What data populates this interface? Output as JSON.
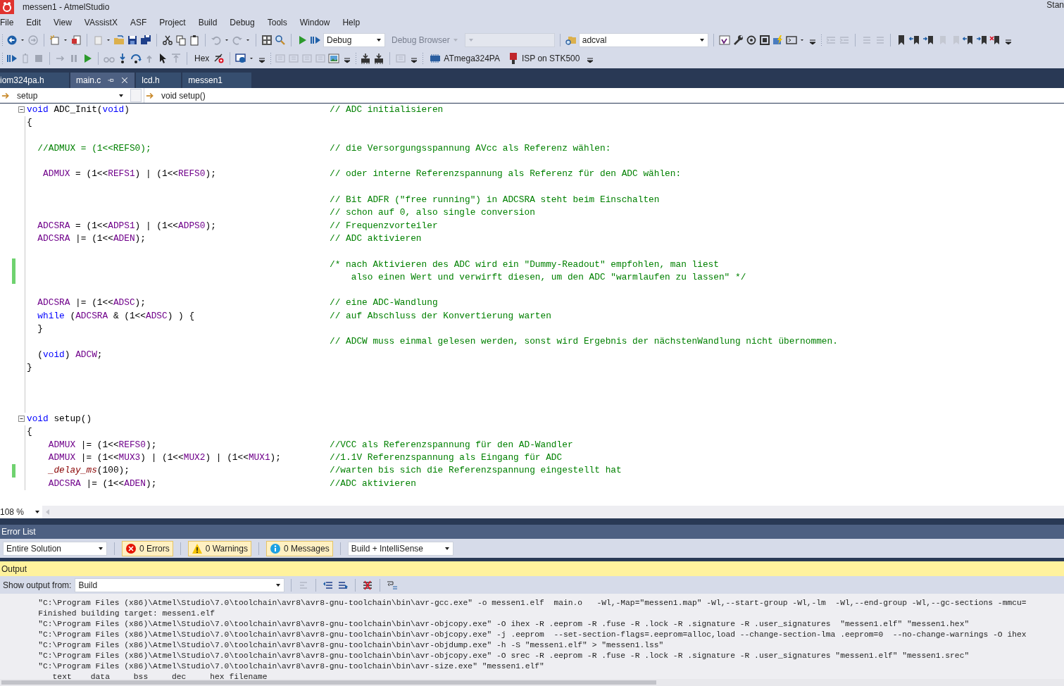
{
  "window": {
    "title": "messen1 - AtmelStudio",
    "corner_text": "Stan"
  },
  "menu": [
    "File",
    "Edit",
    "View",
    "VAssistX",
    "ASF",
    "Project",
    "Build",
    "Debug",
    "Tools",
    "Window",
    "Help"
  ],
  "toolbar": {
    "configuration": "Debug",
    "debug_browser": "Debug Browser",
    "find": "adcval"
  },
  "debug_toolbar": {
    "hex": "Hex",
    "device": "ATmega324PA",
    "tool": "ISP on STK500"
  },
  "tabs": [
    {
      "label": "iom324pa.h",
      "selected": false
    },
    {
      "label": "main.c",
      "selected": true
    },
    {
      "label": "lcd.h",
      "selected": false
    },
    {
      "label": "messen1",
      "selected": false
    }
  ],
  "navigation": {
    "scope": "setup",
    "member": "void setup()"
  },
  "editor": {
    "zoom": "108 %",
    "lines": [
      {
        "changed": false,
        "fold": true,
        "code": [
          {
            "kind": "keyword",
            "text": "void"
          },
          {
            "kind": "plain",
            "text": " ADC_Init("
          },
          {
            "kind": "keyword",
            "text": "void"
          },
          {
            "kind": "plain",
            "text": ")"
          }
        ],
        "comment": "// ADC initialisieren"
      },
      {
        "changed": false,
        "fold": false,
        "code": [
          {
            "kind": "plain",
            "text": "{"
          }
        ]
      },
      {
        "changed": false,
        "fold": false
      },
      {
        "changed": false,
        "fold": false,
        "code": [
          {
            "kind": "comment",
            "text": "  //ADMUX = (1<<REFS0);"
          }
        ],
        "comment": "// die Versorgungsspannung AVcc als Referenz wählen:"
      },
      {
        "changed": false,
        "fold": false
      },
      {
        "changed": false,
        "fold": false,
        "code": [
          {
            "kind": "macro",
            "text": "   ADMUX"
          },
          {
            "kind": "plain",
            "text": " = (1<<"
          },
          {
            "kind": "macro",
            "text": "REFS1"
          },
          {
            "kind": "plain",
            "text": ") | (1<<"
          },
          {
            "kind": "macro",
            "text": "REFS0"
          },
          {
            "kind": "plain",
            "text": ");"
          }
        ],
        "comment": "// oder interne Referenzspannung als Referenz für den ADC wählen:"
      },
      {
        "changed": false,
        "fold": false
      },
      {
        "changed": false,
        "fold": false,
        "comment": "// Bit ADFR (\"free running\") in ADCSRA steht beim Einschalten"
      },
      {
        "changed": false,
        "fold": false,
        "comment": "// schon auf 0, also single conversion"
      },
      {
        "changed": false,
        "fold": false,
        "code": [
          {
            "kind": "macro",
            "text": "  ADCSRA"
          },
          {
            "kind": "plain",
            "text": " = (1<<"
          },
          {
            "kind": "macro",
            "text": "ADPS1"
          },
          {
            "kind": "plain",
            "text": ") | (1<<"
          },
          {
            "kind": "macro",
            "text": "ADPS0"
          },
          {
            "kind": "plain",
            "text": ");"
          }
        ],
        "comment": "// Frequenzvorteiler"
      },
      {
        "changed": false,
        "fold": false,
        "code": [
          {
            "kind": "macro",
            "text": "  ADCSRA"
          },
          {
            "kind": "plain",
            "text": " |= (1<<"
          },
          {
            "kind": "macro",
            "text": "ADEN"
          },
          {
            "kind": "plain",
            "text": ");"
          }
        ],
        "comment": "// ADC aktivieren"
      },
      {
        "changed": false,
        "fold": false
      },
      {
        "changed": true,
        "fold": false,
        "comment": "/* nach Aktivieren des ADC wird ein \"Dummy-Readout\" empfohlen, man liest"
      },
      {
        "changed": true,
        "fold": false,
        "comment": "    also einen Wert und verwirft diesen, um den ADC \"warmlaufen zu lassen\" */"
      },
      {
        "changed": false,
        "fold": false
      },
      {
        "changed": false,
        "fold": false,
        "code": [
          {
            "kind": "macro",
            "text": "  ADCSRA"
          },
          {
            "kind": "plain",
            "text": " |= (1<<"
          },
          {
            "kind": "macro",
            "text": "ADSC"
          },
          {
            "kind": "plain",
            "text": ");"
          }
        ],
        "comment": "// eine ADC-Wandlung"
      },
      {
        "changed": false,
        "fold": false,
        "code": [
          {
            "kind": "keyword",
            "text": "  while"
          },
          {
            "kind": "plain",
            "text": " ("
          },
          {
            "kind": "macro",
            "text": "ADCSRA"
          },
          {
            "kind": "plain",
            "text": " & (1<<"
          },
          {
            "kind": "macro",
            "text": "ADSC"
          },
          {
            "kind": "plain",
            "text": ") ) {"
          }
        ],
        "comment": "// auf Abschluss der Konvertierung warten"
      },
      {
        "changed": false,
        "fold": false,
        "code": [
          {
            "kind": "plain",
            "text": "  }"
          }
        ]
      },
      {
        "changed": false,
        "fold": false,
        "comment": "// ADCW muss einmal gelesen werden, sonst wird Ergebnis der nächstenWandlung nicht übernommen."
      },
      {
        "changed": false,
        "fold": false,
        "code": [
          {
            "kind": "plain",
            "text": "  ("
          },
          {
            "kind": "keyword",
            "text": "void"
          },
          {
            "kind": "plain",
            "text": ") "
          },
          {
            "kind": "macro",
            "text": "ADCW"
          },
          {
            "kind": "plain",
            "text": ";"
          }
        ]
      },
      {
        "changed": false,
        "fold": false,
        "code": [
          {
            "kind": "plain",
            "text": "}"
          }
        ]
      },
      {
        "changed": false,
        "fold": false
      },
      {
        "changed": false,
        "fold": false
      },
      {
        "changed": false,
        "fold": false
      },
      {
        "changed": false,
        "fold": true,
        "code": [
          {
            "kind": "keyword",
            "text": "void"
          },
          {
            "kind": "plain",
            "text": " setup()"
          }
        ]
      },
      {
        "changed": false,
        "fold": false,
        "code": [
          {
            "kind": "plain",
            "text": "{"
          }
        ]
      },
      {
        "changed": false,
        "fold": false,
        "code": [
          {
            "kind": "macro",
            "text": "    ADMUX"
          },
          {
            "kind": "plain",
            "text": " |= (1<<"
          },
          {
            "kind": "macro",
            "text": "REFS0"
          },
          {
            "kind": "plain",
            "text": ");"
          }
        ],
        "comment": "//VCC als Referenzspannung für den AD-Wandler"
      },
      {
        "changed": false,
        "fold": false,
        "code": [
          {
            "kind": "macro",
            "text": "    ADMUX"
          },
          {
            "kind": "plain",
            "text": " |= (1<<"
          },
          {
            "kind": "macro",
            "text": "MUX3"
          },
          {
            "kind": "plain",
            "text": ") | (1<<"
          },
          {
            "kind": "macro",
            "text": "MUX2"
          },
          {
            "kind": "plain",
            "text": ") | (1<<"
          },
          {
            "kind": "macro",
            "text": "MUX1"
          },
          {
            "kind": "plain",
            "text": ");"
          }
        ],
        "comment": "//1.1V Referenzspannung als Eingang für ADC"
      },
      {
        "changed": true,
        "fold": false,
        "code": [
          {
            "kind": "function",
            "text": "    _delay_ms"
          },
          {
            "kind": "plain",
            "text": "(100);"
          }
        ],
        "comment": "//warten bis sich die Referenzspannung eingestellt hat"
      },
      {
        "changed": false,
        "fold": false,
        "code": [
          {
            "kind": "macro",
            "text": "    ADCSRA"
          },
          {
            "kind": "plain",
            "text": " |= (1<<"
          },
          {
            "kind": "macro",
            "text": "ADEN"
          },
          {
            "kind": "plain",
            "text": ");"
          }
        ],
        "comment": "//ADC aktivieren"
      }
    ]
  },
  "error_list": {
    "title": "Error List",
    "scope": "Entire Solution",
    "filters": [
      {
        "kind": "error",
        "label": "0 Errors",
        "selected": true
      },
      {
        "kind": "warning",
        "label": "0 Warnings",
        "selected": true
      },
      {
        "kind": "message",
        "label": "0 Messages",
        "selected": true
      }
    ],
    "source": "Build + IntelliSense"
  },
  "output": {
    "title": "Output",
    "source_label": "Show output from:",
    "source": "Build",
    "lines": [
      "        \"C:\\Program Files (x86)\\Atmel\\Studio\\7.0\\toolchain\\avr8\\avr8-gnu-toolchain\\bin\\avr-gcc.exe\" -o messen1.elf  main.o   -Wl,-Map=\"messen1.map\" -Wl,--start-group -Wl,-lm  -Wl,--end-group -Wl,--gc-sections -mmcu=",
      "        Finished building target: messen1.elf",
      "        \"C:\\Program Files (x86)\\Atmel\\Studio\\7.0\\toolchain\\avr8\\avr8-gnu-toolchain\\bin\\avr-objcopy.exe\" -O ihex -R .eeprom -R .fuse -R .lock -R .signature -R .user_signatures  \"messen1.elf\" \"messen1.hex\"",
      "        \"C:\\Program Files (x86)\\Atmel\\Studio\\7.0\\toolchain\\avr8\\avr8-gnu-toolchain\\bin\\avr-objcopy.exe\" -j .eeprom  --set-section-flags=.eeprom=alloc,load --change-section-lma .eeprom=0  --no-change-warnings -O ihex",
      "        \"C:\\Program Files (x86)\\Atmel\\Studio\\7.0\\toolchain\\avr8\\avr8-gnu-toolchain\\bin\\avr-objdump.exe\" -h -S \"messen1.elf\" > \"messen1.lss\"",
      "        \"C:\\Program Files (x86)\\Atmel\\Studio\\7.0\\toolchain\\avr8\\avr8-gnu-toolchain\\bin\\avr-objcopy.exe\" -O srec -R .eeprom -R .fuse -R .lock -R .signature -R .user_signatures \"messen1.elf\" \"messen1.srec\"",
      "        \"C:\\Program Files (x86)\\Atmel\\Studio\\7.0\\toolchain\\avr8\\avr8-gnu-toolchain\\bin\\avr-size.exe\" \"messen1.elf\"",
      "           text    data     bss     dec     hex filename"
    ]
  }
}
